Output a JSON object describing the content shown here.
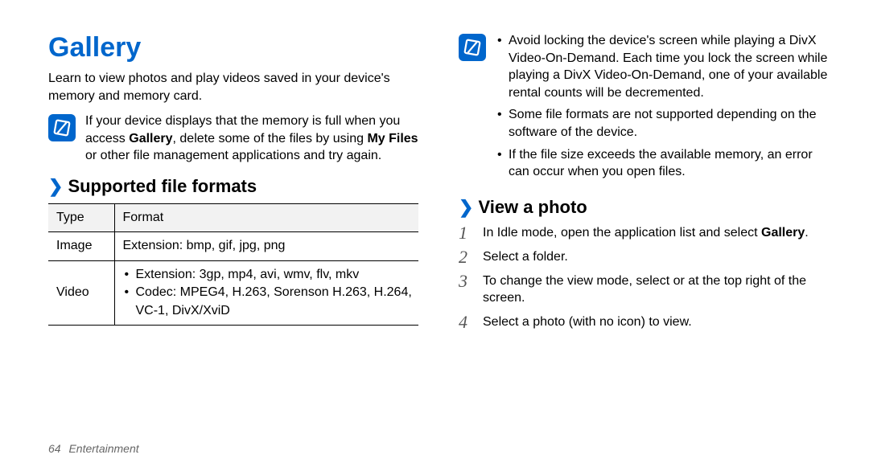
{
  "left": {
    "title": "Gallery",
    "intro": "Learn to view photos and play videos saved in your device's memory and memory card.",
    "note1_lead": "If your device displays that the memory is full when you access ",
    "note1_bold1": "Gallery",
    "note1_mid": ", delete some of the files by using ",
    "note1_bold2": "My Files",
    "note1_tail": " or other file management applications and try again.",
    "section_supported": "Supported file formats",
    "table": {
      "header": {
        "type": "Type",
        "format": "Format"
      },
      "rows": {
        "image": {
          "type": "Image",
          "format": "Extension: bmp, gif, jpg, png"
        },
        "video": {
          "type": "Video",
          "formats": [
            "Extension: 3gp, mp4, avi, wmv, flv, mkv",
            "Codec: MPEG4, H.263, Sorenson H.263, H.264, VC-1, DivX/XviD"
          ]
        }
      }
    }
  },
  "right": {
    "notes": [
      "Avoid locking the device's screen while playing a DivX Video-On-Demand. Each time you lock the screen while playing a DivX Video-On-Demand, one of your available rental counts will be decremented.",
      "Some file formats are not supported depending on the software of the device.",
      "If the file size exceeds the available memory, an error can occur when you open files."
    ],
    "section_view": "View a photo",
    "steps": {
      "s1_lead": "In Idle mode, open the application list and select ",
      "s1_bold": "Gallery",
      "s1_tail": ".",
      "s2": "Select a folder.",
      "s3": "To change the view mode, select       or       at the top right of the screen.",
      "s4": "Select a photo (with no icon) to view."
    }
  },
  "footer": {
    "page": "64",
    "category": "Entertainment"
  }
}
